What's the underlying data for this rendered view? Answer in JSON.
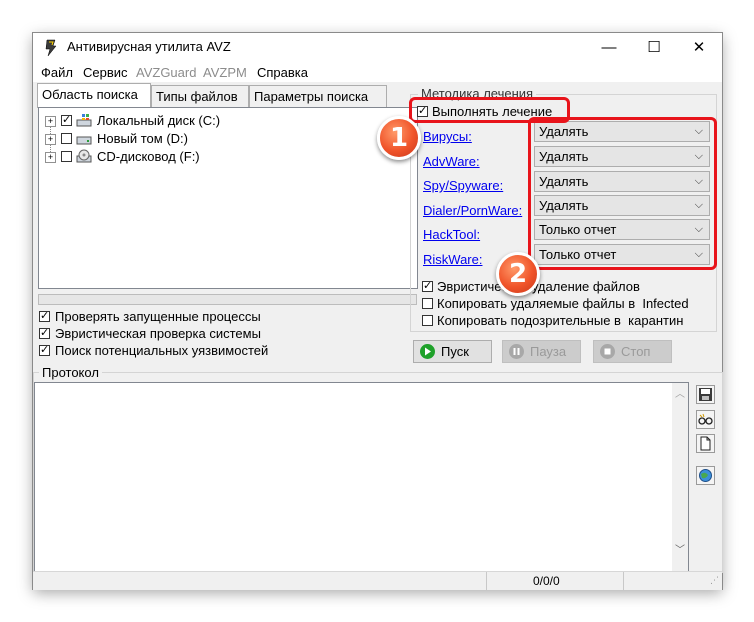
{
  "window": {
    "title": "Антивирусная утилита AVZ",
    "controls": {
      "minimize": "—",
      "maximize": "☐",
      "close": "✕"
    }
  },
  "menu": [
    {
      "label": "Файл",
      "enabled": true
    },
    {
      "label": "Сервис",
      "enabled": true
    },
    {
      "label": "AVZGuard",
      "enabled": false
    },
    {
      "label": "AVZPM",
      "enabled": false
    },
    {
      "label": "Справка",
      "enabled": true
    }
  ],
  "tabs": [
    {
      "label": "Область поиска",
      "active": true
    },
    {
      "label": "Типы файлов",
      "active": false
    },
    {
      "label": "Параметры поиска",
      "active": false
    }
  ],
  "drives": [
    {
      "label": "Локальный диск (C:)",
      "checked": true,
      "icon": "local-disk-icon"
    },
    {
      "label": "Новый том (D:)",
      "checked": false,
      "icon": "hard-drive-icon"
    },
    {
      "label": "CD-дисковод (F:)",
      "checked": false,
      "icon": "cd-drive-icon"
    }
  ],
  "scan_options": [
    {
      "label": "Проверять запущенные процессы",
      "checked": true
    },
    {
      "label": "Эвристическая проверка системы",
      "checked": true
    },
    {
      "label": "Поиск потенциальных уязвимостей",
      "checked": true
    }
  ],
  "treatment": {
    "group_label": "Методика лечения",
    "perform_label": "Выполнять лечение",
    "perform_checked": true,
    "rows": [
      {
        "label": "Вирусы:",
        "value": "Удалять"
      },
      {
        "label": "AdvWare:",
        "value": "Удалять"
      },
      {
        "label": "Spy/Spyware:",
        "value": "Удалять"
      },
      {
        "label": "Dialer/PornWare:",
        "value": "Удалять"
      },
      {
        "label": "HackTool:",
        "value": "Только отчет"
      },
      {
        "label": "RiskWare:",
        "value": "Только отчет"
      }
    ],
    "options": [
      {
        "label": "Эвристическое удаление файлов",
        "checked": true
      },
      {
        "label": "Копировать удаляемые файлы в  Infected",
        "checked": false
      },
      {
        "label": "Копировать подозрительные в  карантин",
        "checked": false
      }
    ]
  },
  "buttons": {
    "start": "Пуск",
    "pause": "Пауза",
    "stop": "Стоп"
  },
  "protocol": {
    "label": "Протокол",
    "tools": [
      "save-icon",
      "glasses-icon",
      "document-icon",
      "globe-icon"
    ]
  },
  "status": {
    "counter": "0/0/0"
  },
  "annotations": [
    {
      "number": "1"
    },
    {
      "number": "2"
    }
  ],
  "colors": {
    "accent_red": "#e8141b",
    "marker_orange": "#f0542a",
    "link_blue": "#0000ee"
  }
}
